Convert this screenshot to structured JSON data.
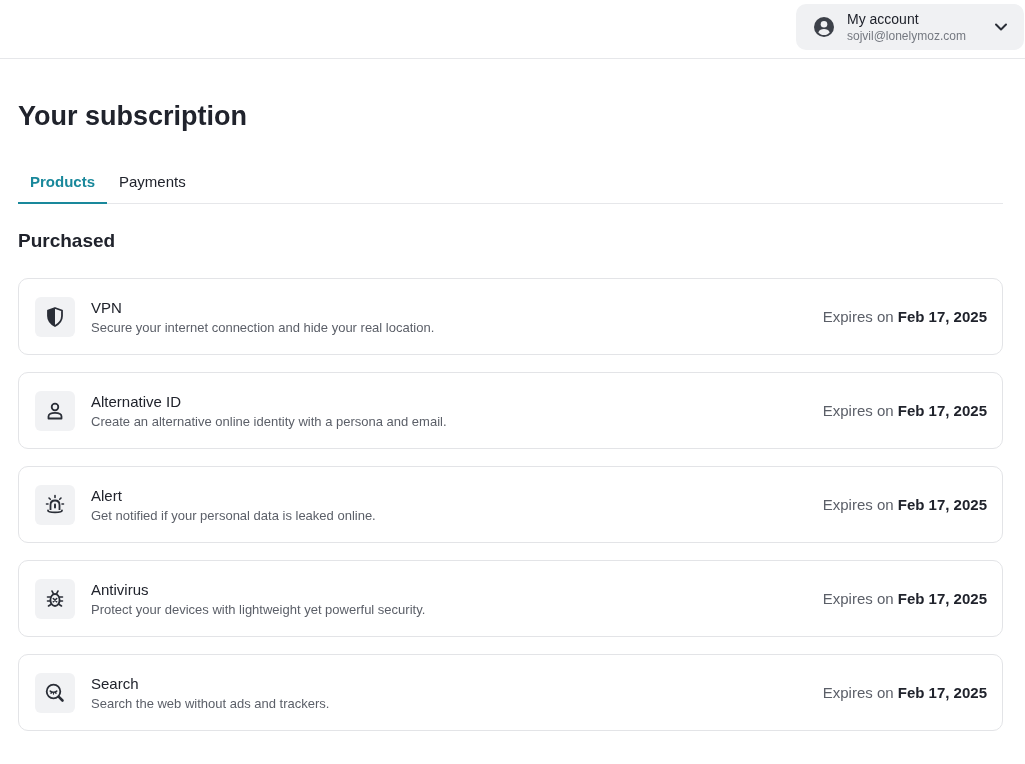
{
  "account": {
    "label": "My account",
    "email": "sojvil@lonelymoz.com"
  },
  "page": {
    "title": "Your subscription"
  },
  "tabs": [
    {
      "label": "Products",
      "selected": true
    },
    {
      "label": "Payments",
      "selected": false
    }
  ],
  "section": {
    "heading": "Purchased"
  },
  "products": [
    {
      "kind": "shield",
      "name": "VPN",
      "description": "Secure your internet connection and hide your real location.",
      "expiry": "Expires on **Feb 17, 2025**"
    },
    {
      "kind": "person",
      "name": "Alternative ID",
      "description": "Create an alternative online identity with a persona and email.",
      "expiry": "Expires on **Feb 17, 2025**"
    },
    {
      "kind": "siren",
      "name": "Alert",
      "description": "Get notified if your personal data is leaked online.",
      "expiry": "Expires on **Feb 17, 2025**"
    },
    {
      "kind": "bug",
      "name": "Antivirus",
      "description": "Protect your devices with lightweight yet powerful security.",
      "expiry": "Expires on **Feb 17, 2025**"
    },
    {
      "kind": "magnifier",
      "name": "Search",
      "description": "Search the web without ads and trackers.",
      "expiry": "Expires on **Feb 17, 2025**"
    }
  ]
}
